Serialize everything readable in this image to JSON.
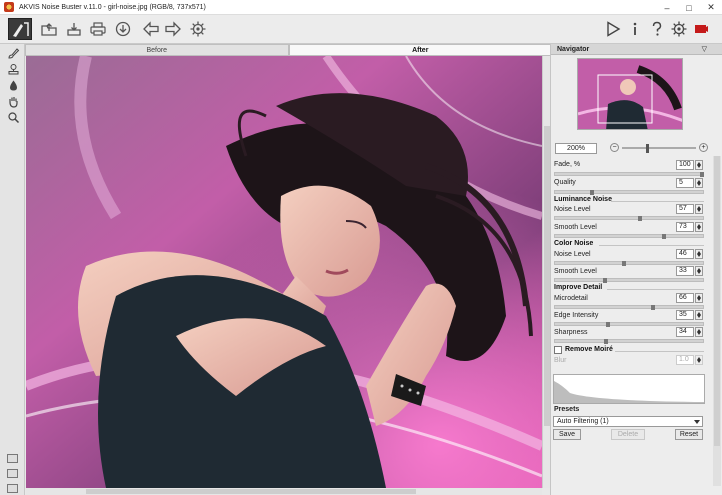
{
  "window": {
    "title": "AKVIS Noise Buster v.11.0 - girl-noise.jpg (RGB/8, 737x571)",
    "controls": [
      "–",
      "□",
      "✕"
    ]
  },
  "toolbar": {
    "left_icons": [
      "open-icon",
      "save-icon",
      "print-icon",
      "share-icon",
      "undo-icon",
      "redo-icon",
      "settings-gear-icon"
    ],
    "right_icons": [
      "run-icon",
      "info-icon",
      "help-icon",
      "preferences-icon",
      "red-indicator-icon"
    ]
  },
  "tabs": [
    {
      "label": "Before",
      "active": false
    },
    {
      "label": "After",
      "active": true
    }
  ],
  "navigator": {
    "title": "Navigator",
    "zoom": "200%",
    "zoom_minus": "−",
    "zoom_plus": "+"
  },
  "settings": {
    "fade": {
      "label": "Fade, %",
      "value": "100"
    },
    "quality": {
      "label": "Quality",
      "value": "5"
    },
    "luminance_noise": {
      "title": "Luminance Noise",
      "noise_level": {
        "label": "Noise Level",
        "value": "57"
      },
      "smooth_level": {
        "label": "Smooth Level",
        "value": "73"
      }
    },
    "color_noise": {
      "title": "Color Noise",
      "noise_level": {
        "label": "Noise Level",
        "value": "46"
      },
      "smooth_level": {
        "label": "Smooth Level",
        "value": "33"
      }
    },
    "improve_detail": {
      "title": "Improve Detail",
      "microdetail": {
        "label": "Microdetail",
        "value": "66"
      },
      "edge_intensity": {
        "label": "Edge Intensity",
        "value": "35"
      },
      "sharpness": {
        "label": "Sharpness",
        "value": "34"
      }
    },
    "remove_moire": {
      "title": "Remove Moiré",
      "checked": false,
      "blur_label": "Blur",
      "blur_value": "1.0"
    }
  },
  "presets": {
    "title": "Presets",
    "selected": "Auto Filtering (1)",
    "save_label": "Save",
    "delete_label": "Delete",
    "reset_label": "Reset"
  }
}
